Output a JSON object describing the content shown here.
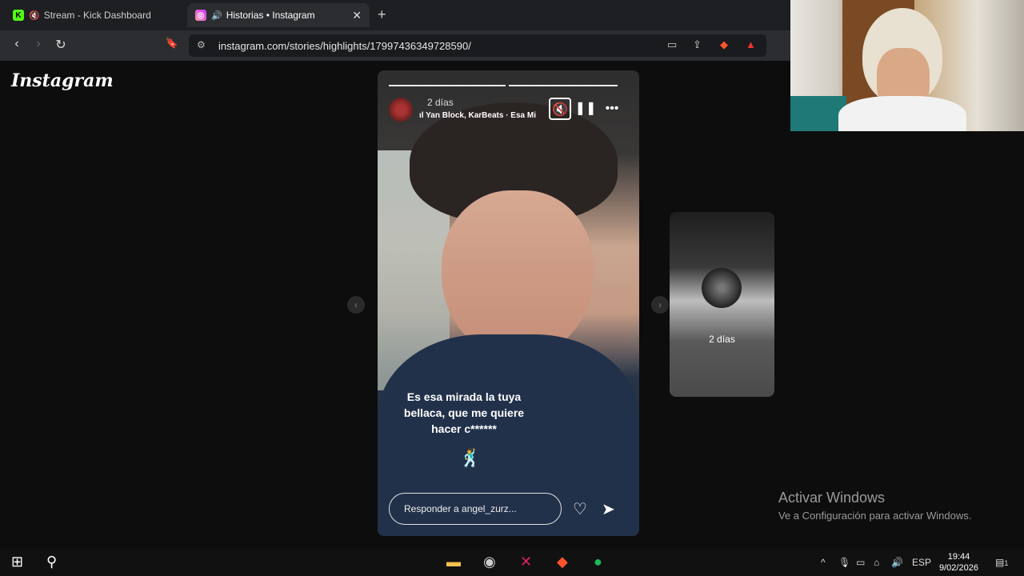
{
  "browser": {
    "tabs": [
      {
        "title": "Stream - Kick Dashboard",
        "icon": "kick-icon",
        "muted": true,
        "active": false
      },
      {
        "title": "Historias • Instagram",
        "icon": "instagram-icon",
        "audio": true,
        "active": true
      }
    ],
    "url": "instagram.com/stories/highlights/17997436349728590/"
  },
  "instagram": {
    "logo": "Instagram",
    "story": {
      "time": "2 días",
      "music": "Yan Block, KarBeats · Esa Mi",
      "caption_line1": "Es esa mirada la tuya",
      "caption_line2": "bellaca, que me quiere",
      "caption_line3": "hacer c******",
      "reply_placeholder": "Responder a angel_zurz..."
    },
    "next_story": {
      "time": "2 días"
    }
  },
  "windows_watermark": {
    "title": "Activar Windows",
    "subtitle": "Ve a Configuración para activar Windows."
  },
  "taskbar": {
    "language": "ESP",
    "time": "19:44",
    "date": "9/02/2026",
    "notification_count": "1"
  },
  "colors": {
    "brave_orange": "#fb542b",
    "spotify_green": "#1db954",
    "kick_green": "#53fc18"
  }
}
